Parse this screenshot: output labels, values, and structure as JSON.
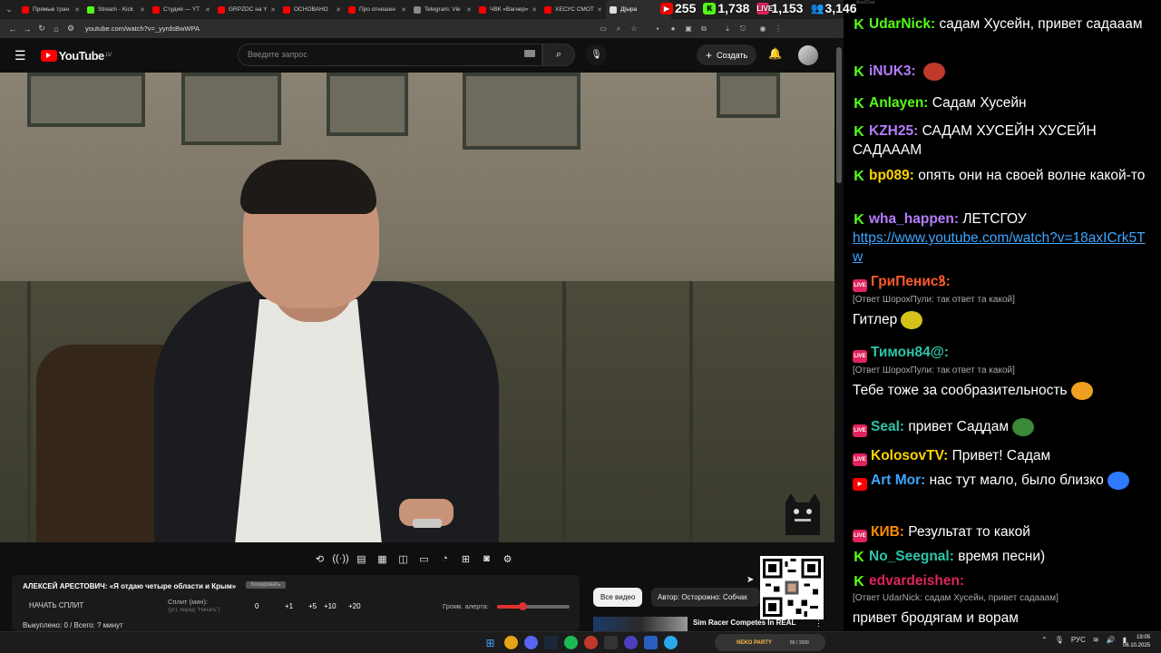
{
  "browser": {
    "tabs": [
      {
        "label": "Прямые тран",
        "color": "#ff0000"
      },
      {
        "label": "Stream - Kick",
        "color": "#53fc18"
      },
      {
        "label": "Студия — YT",
        "color": "#ff0000"
      },
      {
        "label": "GRPZDC на Y",
        "color": "#ff0000"
      },
      {
        "label": "ОСНОВАНО",
        "color": "#ff0000"
      },
      {
        "label": "Про отношен",
        "color": "#ff0000"
      },
      {
        "label": "Telegram: Vie",
        "color": "#888888"
      },
      {
        "label": "ЧВК «Вагнер»",
        "color": "#ff0000"
      },
      {
        "label": "ХЕСУС СМОТ",
        "color": "#ff0000"
      },
      {
        "label": "Д[ыра",
        "color": "#dddddd"
      }
    ],
    "url": "youtube.com/watch?v=_yyrdsBwWPA"
  },
  "stats": {
    "youtube_viewers": "255",
    "kick_viewers": "1,738",
    "live_viewers": "1,153",
    "total_viewers": "3,146"
  },
  "youtube": {
    "logo_text": "YouTube",
    "logo_region": "LV",
    "search_placeholder": "Введите запрос",
    "create_label": "Создать"
  },
  "player_controls": [
    "loop-icon",
    "broadcast-icon",
    "cinema-icon",
    "clapper-icon",
    "pip-icon",
    "miniplayer-icon",
    "speed-icon",
    "screenshot-add-icon",
    "camera-icon",
    "settings-icon"
  ],
  "widget": {
    "title": "АЛЕКСЕЙ АРЕСТОВИЧ: «Я отдаю четыре области и Крым»",
    "badge": "Копировать",
    "start_label": "НАЧАТЬ СПЛИТ",
    "split_label": "Сплит (мин):",
    "split_hint": "(уст. перед \"Начать\")",
    "split_value": "0",
    "increments": [
      "+1",
      "+5",
      "+10",
      "+20"
    ],
    "volume_label": "Громк. алерта:",
    "volume_level": 0.35,
    "bought": "Выкуплено: 0 / Всего: ? минут"
  },
  "recommendations": {
    "chip_all": "Все видео",
    "chip_author": "Автор: Осторожно: Собчак",
    "first_title": "Sim Racer Competes In REAL"
  },
  "chat": {
    "window_title": "AxelChat",
    "messages": [
      {
        "platform": "kick",
        "nick": "UdarNick:",
        "nick_color": "#53fc18",
        "text": "садам Хусейн, привет садааам"
      },
      {
        "platform": "kick",
        "nick": "iNUK3:",
        "nick_color": "#b57cff",
        "text": ""
      },
      {
        "platform": "kick",
        "nick": "Anlayen:",
        "nick_color": "#53fc18",
        "text": "Садам Хусейн"
      },
      {
        "platform": "kick",
        "nick": "KZH25:",
        "nick_color": "#b57cff",
        "text": "САДАМ ХУСЕЙН ХУСЕЙН САДАААМ"
      },
      {
        "platform": "kick",
        "nick": "bp089:",
        "nick_color": "#ffd400",
        "text": "опять они на своей волне какой-то"
      },
      {
        "platform": "kick",
        "nick": "wha_happen:",
        "nick_color": "#b57cff",
        "text": "ЛЕТСГОУ",
        "link": "https://www.youtube.com/watch?v=18axICrk5Tw"
      },
      {
        "platform": "live",
        "nick": "ГриПенисꝸ:",
        "nick_color": "#ff5a2a",
        "reply": "[Ответ ШорохПули: так ответ та какой]",
        "text": "Гитлер"
      },
      {
        "platform": "live",
        "nick": "Тимон84@:",
        "nick_color": "#2ec4a8",
        "reply": "[Ответ ШорохПули: так ответ та какой]",
        "text": "Тебе тоже за сообразительность"
      },
      {
        "platform": "live",
        "nick": "Seal:",
        "nick_color": "#2ec4a8",
        "text": "привет Саддам"
      },
      {
        "platform": "live",
        "nick": "KolosovTV:",
        "nick_color": "#ffd400",
        "text": "Привет! Садам"
      },
      {
        "platform": "yt",
        "nick": "Art Mor:",
        "nick_color": "#3ea6ff",
        "text": "нас тут мало, было близко"
      },
      {
        "platform": "live",
        "nick": "КИВ:",
        "nick_color": "#ff8c00",
        "text": "Результат то какой"
      },
      {
        "platform": "kick",
        "nick": "No_Seegnal:",
        "nick_color": "#2ec4a8",
        "text": "время песни)"
      },
      {
        "platform": "kick",
        "nick": "edvardeishen:",
        "nick_color": "#e0245e",
        "reply": "[Ответ UdarNick: садам Хусейн, привет садааам]",
        "text": "привет бродягам и ворам"
      }
    ]
  },
  "taskbar": {
    "game_title": "NEKO PARTY",
    "game_progress": "50 / 1500",
    "lang": "РУС",
    "time": "19:05",
    "date": "06.10.2025"
  }
}
